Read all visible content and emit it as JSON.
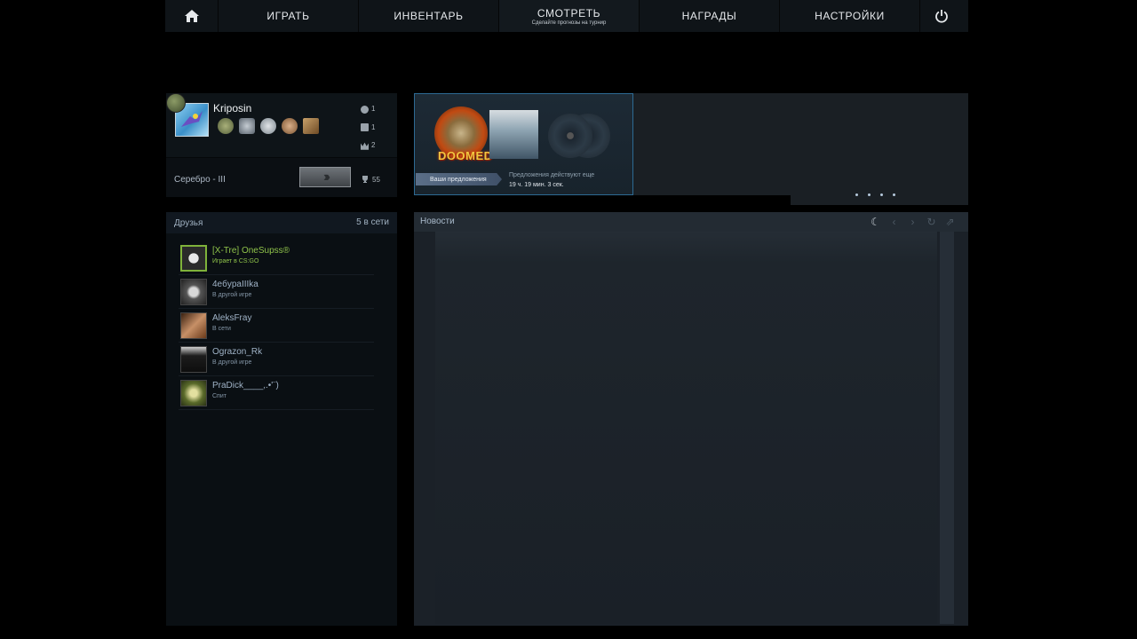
{
  "nav": {
    "home_icon": "home-icon",
    "items": [
      {
        "label": "ИГРАТЬ"
      },
      {
        "label": "ИНВЕНТАРЬ"
      },
      {
        "label": "СМОТРЕТЬ",
        "sub": "Сделайте прогнозы на турнир"
      },
      {
        "label": "НАГРАДЫ"
      },
      {
        "label": "НАСТРОЙКИ"
      }
    ],
    "power_icon": "power-icon"
  },
  "profile": {
    "name": "Kriposin",
    "stats": [
      "1",
      "1",
      "2"
    ],
    "rank": "Серебро - III",
    "trophy_count": "55"
  },
  "banner": {
    "title": "DOOMED",
    "offer_button": "Ваши предложения",
    "offer_line1": "Предложения действуют еще",
    "offer_line2": "19 ч. 19 мин. 3 сек."
  },
  "friends": {
    "title": "Друзья",
    "online_count": "5 в сети",
    "list": [
      {
        "name": "[X-Tre] OneSupss®",
        "status": "Играет в CS:GO"
      },
      {
        "name": "4eбypaIIIka",
        "status": "В другой игре"
      },
      {
        "name": "AleksFray",
        "status": "В сети"
      },
      {
        "name": "Ograzon_Rk",
        "status": "В другой игре"
      },
      {
        "name": "PraDick____,.•'¨)",
        "status": "Спит"
      }
    ]
  },
  "news": {
    "title": "Новости"
  },
  "colors": {
    "ingame_green": "#8fc34a",
    "accent_blue": "#2d6a93"
  }
}
